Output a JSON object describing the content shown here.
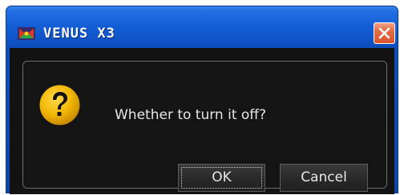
{
  "window": {
    "title": "VENUS X3",
    "app_icon": "venus-app-icon",
    "close_icon": "close-icon"
  },
  "dialog": {
    "icon": "question-icon",
    "message": "Whether to turn it off?",
    "ok_label": "OK",
    "cancel_label": "Cancel"
  },
  "colors": {
    "titlebar": "#1459d2",
    "close_button": "#e0623c",
    "dialog_background": "#141414",
    "question_icon": "#f2b705"
  }
}
